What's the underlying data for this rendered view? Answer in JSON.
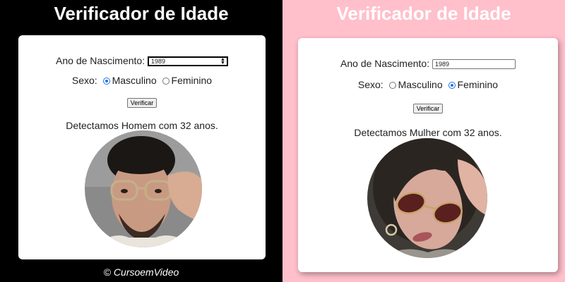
{
  "left": {
    "title": "Verificador de Idade",
    "birth_label": "Ano de Nascimento:",
    "birth_value": "1989",
    "sex_label": "Sexo:",
    "option_male": "Masculino",
    "option_female": "Feminino",
    "selected_sex": "Masculino",
    "button_label": "Verificar",
    "result_text": "Detectamos Homem com 32 anos.",
    "footer_symbol": "©",
    "footer_brand": "CursoemVideo"
  },
  "right": {
    "title": "Verificador de Idade",
    "birth_label": "Ano de Nascimento:",
    "birth_value": "1989",
    "sex_label": "Sexo:",
    "option_male": "Masculino",
    "option_female": "Feminino",
    "selected_sex": "Feminino",
    "button_label": "Verificar",
    "result_text": "Detectamos Mulher com 32 anos."
  },
  "colors": {
    "left_background": "#000000",
    "right_background": "#FFBFCB",
    "radio_accent": "#1a73e8"
  },
  "icons": [
    "man-portrait",
    "woman-portrait",
    "spinner-arrows"
  ]
}
